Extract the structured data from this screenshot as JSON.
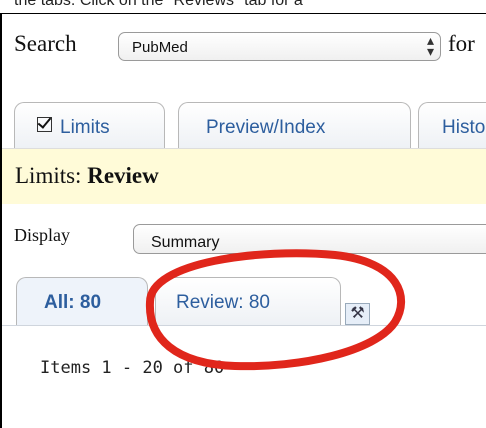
{
  "instruction": {
    "text": "the tabs. Click on the \"Reviews\" tab for a"
  },
  "search": {
    "label": "Search",
    "database": "PubMed",
    "for_label": "for"
  },
  "tabs": [
    {
      "label": "Limits",
      "checked": true
    },
    {
      "label": "Preview/Index"
    },
    {
      "label": "History"
    }
  ],
  "limits_bar": {
    "prefix": "Limits:",
    "value": "Review"
  },
  "display": {
    "label": "Display",
    "value": "Summary"
  },
  "result_tabs": [
    {
      "label": "All: 80",
      "active": true
    },
    {
      "label": "Review: 80",
      "active": false
    }
  ],
  "items_text": "Items 1 - 20 of 80",
  "icons": {
    "tools": "tools-icon",
    "select_arrows": "updown-arrows-icon"
  },
  "colors": {
    "link": "#2d5e9e",
    "limits_bg": "#fffbd8",
    "annotation": "#e0261b"
  }
}
